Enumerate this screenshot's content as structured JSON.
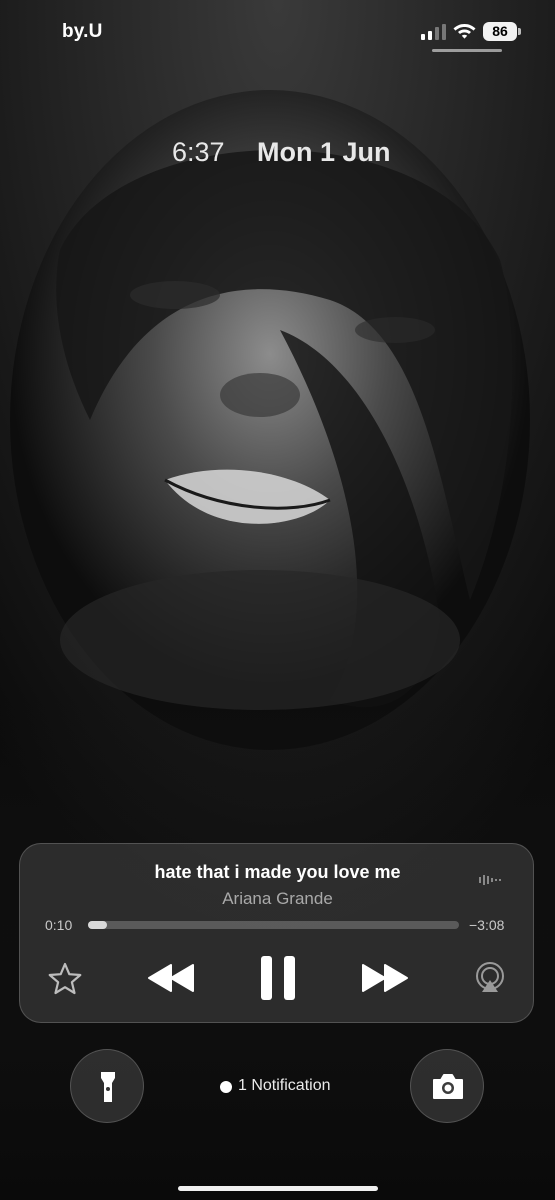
{
  "status_bar": {
    "carrier": "by.U",
    "battery": "86",
    "signal_icon": "cellular-signal-icon",
    "wifi_icon": "wifi-icon"
  },
  "lock_screen": {
    "time": "6:37",
    "date": "Mon 1 Jun"
  },
  "now_playing": {
    "title": "hate that i made you love me",
    "artist": "Ariana Grande",
    "elapsed": "0:10",
    "remaining": "−3:08",
    "progress": 0.05,
    "controls": [
      "star-icon",
      "rewind-icon",
      "pause-icon",
      "fast-forward-icon",
      "airplay-icon"
    ]
  },
  "bottom": {
    "notification": "1 Notification",
    "left_button_icon": "flashlight-icon",
    "right_button_icon": "camera-icon"
  },
  "colors": {
    "text_primary": "#ffffff",
    "text_secondary": "#a9a9a9",
    "player_bg": "rgba(70,70,70,0.55)"
  }
}
